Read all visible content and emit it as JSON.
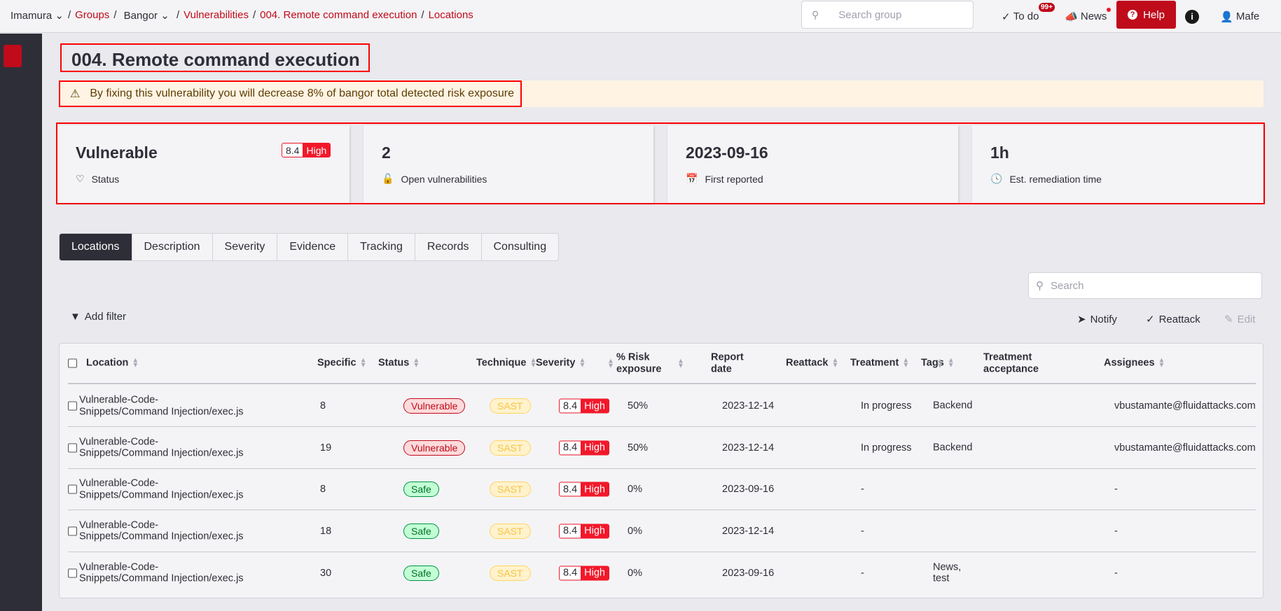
{
  "breadcrumb": {
    "org": "Imamura",
    "groups": "Groups",
    "group": "Bangor",
    "vulnerabilities": "Vulnerabilities",
    "finding": "004. Remote command execution",
    "current": "Locations"
  },
  "topbar": {
    "search_placeholder": "Search group",
    "todo": "To do",
    "todo_badge": "99+",
    "news": "News",
    "help": "Help",
    "user": "Mafe"
  },
  "page": {
    "title": "004. Remote command execution",
    "warning": "By fixing this vulnerability you will decrease 8% of bangor total detected risk exposure"
  },
  "cards": [
    {
      "value": "Vulnerable",
      "label": "Status",
      "icon": "heartbeat-icon",
      "severity_score": "8.4",
      "severity_level": "High"
    },
    {
      "value": "2",
      "label": "Open vulnerabilities",
      "icon": "unlock-icon"
    },
    {
      "value": "2023-09-16",
      "label": "First reported",
      "icon": "calendar-icon"
    },
    {
      "value": "1h",
      "label": "Est. remediation time",
      "icon": "clock-icon"
    }
  ],
  "tabs": [
    "Locations",
    "Description",
    "Severity",
    "Evidence",
    "Tracking",
    "Records",
    "Consulting"
  ],
  "toolbar": {
    "search_placeholder": "Search",
    "add_filter": "Add filter",
    "notify": "Notify",
    "reattack": "Reattack",
    "edit": "Edit"
  },
  "table": {
    "columns": [
      "Location",
      "Specific",
      "Status",
      "Technique",
      "Severity",
      "% Risk exposure",
      "Report date",
      "Reattack",
      "Treatment",
      "Tags",
      "Treatment acceptance",
      "Assignees"
    ],
    "rows": [
      {
        "location": "Vulnerable-Code-Snippets/Command Injection/exec.js",
        "specific": "8",
        "status": "Vulnerable",
        "technique": "SAST",
        "score": "8.4",
        "level": "High",
        "risk": "50%",
        "date": "2023-12-14",
        "reattack": "",
        "treatment": "In progress",
        "tags": "Backend",
        "acceptance": "",
        "assignee": "vbustamante@fluidattacks.com"
      },
      {
        "location": "Vulnerable-Code-Snippets/Command Injection/exec.js",
        "specific": "19",
        "status": "Vulnerable",
        "technique": "SAST",
        "score": "8.4",
        "level": "High",
        "risk": "50%",
        "date": "2023-12-14",
        "reattack": "",
        "treatment": "In progress",
        "tags": "Backend",
        "acceptance": "",
        "assignee": "vbustamante@fluidattacks.com"
      },
      {
        "location": "Vulnerable-Code-Snippets/Command Injection/exec.js",
        "specific": "8",
        "status": "Safe",
        "technique": "SAST",
        "score": "8.4",
        "level": "High",
        "risk": "0%",
        "date": "2023-09-16",
        "reattack": "",
        "treatment": "-",
        "tags": "",
        "acceptance": "",
        "assignee": "-"
      },
      {
        "location": "Vulnerable-Code-Snippets/Command Injection/exec.js",
        "specific": "18",
        "status": "Safe",
        "technique": "SAST",
        "score": "8.4",
        "level": "High",
        "risk": "0%",
        "date": "2023-12-14",
        "reattack": "",
        "treatment": "-",
        "tags": "",
        "acceptance": "",
        "assignee": "-"
      },
      {
        "location": "Vulnerable-Code-Snippets/Command Injection/exec.js",
        "specific": "30",
        "status": "Safe",
        "technique": "SAST",
        "score": "8.4",
        "level": "High",
        "risk": "0%",
        "date": "2023-09-16",
        "reattack": "",
        "treatment": "-",
        "tags": "News, test",
        "acceptance": "",
        "assignee": "-"
      }
    ]
  },
  "colors": {
    "brand": "#bf0b1a",
    "high": "#f2182a",
    "sidebar": "#2e2e38"
  }
}
